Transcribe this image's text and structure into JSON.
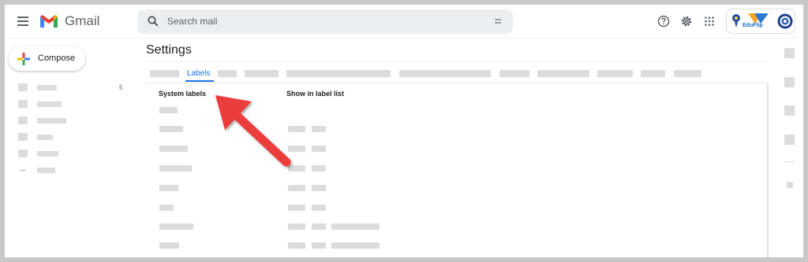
{
  "header": {
    "app_name": "Gmail",
    "search_placeholder": "Search mail",
    "icons": [
      "menu-icon",
      "gmail-logo",
      "search-icon",
      "search-options-icon",
      "help-icon",
      "settings-icon",
      "apps-icon"
    ],
    "brand_text": "EduFlip"
  },
  "sidebar": {
    "compose_label": "Compose",
    "inbox_count": "5"
  },
  "settings": {
    "title": "Settings",
    "active_tab": "Labels",
    "columns": {
      "system_labels": "System labels",
      "show_in_label_list": "Show in label list"
    }
  },
  "colors": {
    "accent": "#1a73e8",
    "arrow": "#ec3d3d",
    "gmail_red": "#ea4335",
    "placeholder_gray": "#dcdcdc"
  }
}
